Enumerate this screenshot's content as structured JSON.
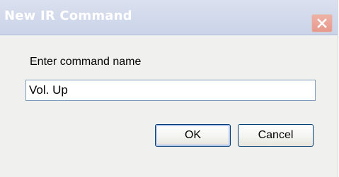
{
  "dialog": {
    "title": "New IR Command",
    "close_icon": "close-icon",
    "prompt": "Enter command name",
    "input_value": "Vol. Up",
    "ok_label": "OK",
    "cancel_label": "Cancel"
  },
  "colors": {
    "titlebar": "#cad3e9",
    "close_button": "#e69a8c",
    "dialog_background": "#f0f0ee",
    "input_border": "#7f9db9",
    "button_border": "#003c74"
  }
}
